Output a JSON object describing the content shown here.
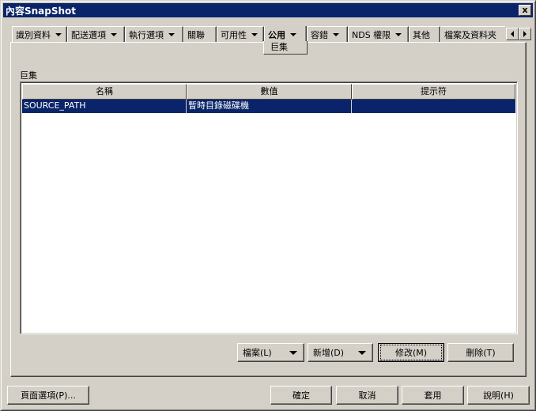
{
  "window": {
    "title": "內容SnapShot",
    "close_label": "x"
  },
  "tabs": [
    {
      "label": "識別資料",
      "dropdown": true
    },
    {
      "label": "配送選項",
      "dropdown": true
    },
    {
      "label": "執行選項",
      "dropdown": true
    },
    {
      "label": "關聯",
      "dropdown": false
    },
    {
      "label": "可用性",
      "dropdown": true
    },
    {
      "label": "公用",
      "dropdown": true,
      "active": true
    },
    {
      "label": "容錯",
      "dropdown": true
    },
    {
      "label": "NDS 權限",
      "dropdown": true
    },
    {
      "label": "其他",
      "dropdown": false
    },
    {
      "label": "檔案及資料夾",
      "dropdown": false
    }
  ],
  "active_subtab": "巨集",
  "group_label": "巨集",
  "table": {
    "columns": [
      "名稱",
      "數值",
      "提示符"
    ],
    "rows": [
      {
        "name": "SOURCE_PATH",
        "value": "暫時目錄磁碟機",
        "prompt": ""
      }
    ]
  },
  "panel_buttons": {
    "file": "檔案(L)",
    "add": "新增(D)",
    "modify": "修改(M)",
    "delete": "刪除(T)"
  },
  "footer_buttons": {
    "page_options": "頁面選項(P)...",
    "ok": "確定",
    "cancel": "取消",
    "apply": "套用",
    "help": "說明(H)"
  },
  "colors": {
    "selection": "#0a246a",
    "titlebar": "#0a246a",
    "face": "#d4d0c8"
  }
}
